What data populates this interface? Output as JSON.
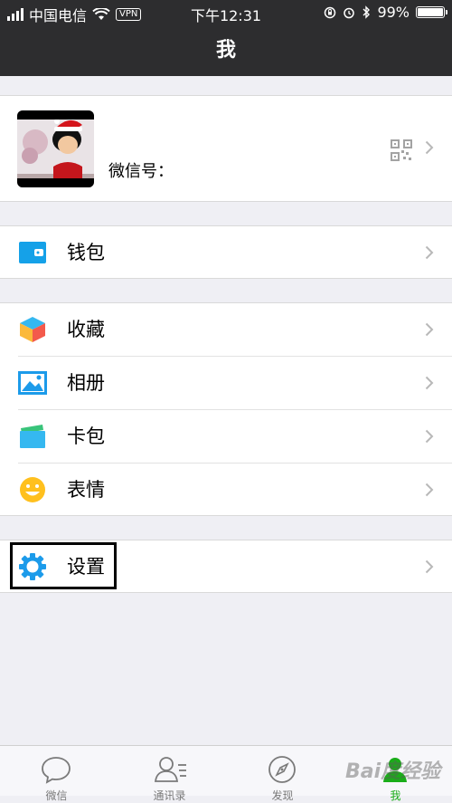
{
  "status_bar": {
    "carrier": "中国电信",
    "vpn": "VPN",
    "time": "下午12:31",
    "battery": "99%",
    "battery_level": 0.99
  },
  "nav": {
    "title": "我"
  },
  "profile": {
    "wechat_id_label": "微信号："
  },
  "menu": {
    "wallet": "钱包",
    "favorites": "收藏",
    "album": "相册",
    "cards": "卡包",
    "stickers": "表情",
    "settings": "设置"
  },
  "tabs": [
    {
      "label": "微信",
      "icon": "chat-bubble-icon"
    },
    {
      "label": "通讯录",
      "icon": "contacts-icon"
    },
    {
      "label": "发现",
      "icon": "compass-icon"
    },
    {
      "label": "我",
      "icon": "person-icon",
      "active": true
    }
  ],
  "colors": {
    "header_bg": "#2d2d2f",
    "accent_green": "#1aad19",
    "settings_blue": "#1c9bea",
    "wallet_blue": "#15a1e8"
  },
  "watermark": "Bai度经验"
}
